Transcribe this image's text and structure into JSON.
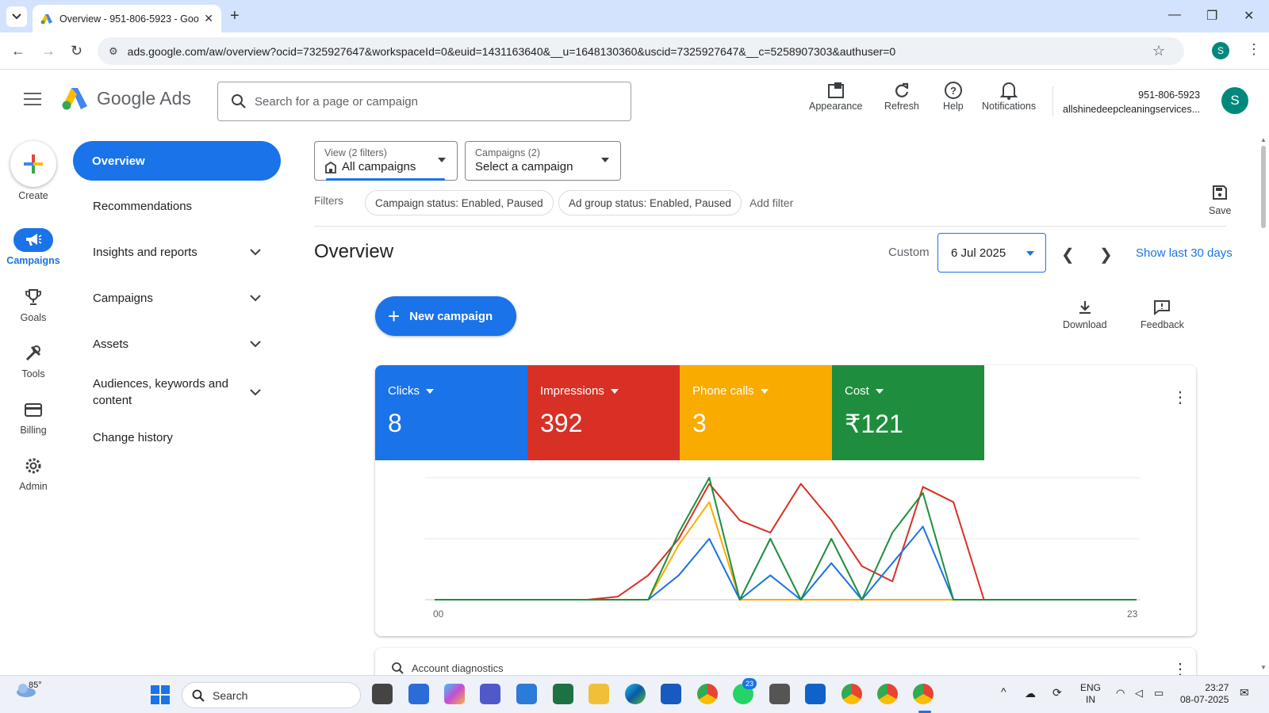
{
  "browser": {
    "tab_title": "Overview - 951-806-5923 - Goo",
    "url": "ads.google.com/aw/overview?ocid=7325927647&workspaceId=0&euid=1431163640&__u=1648130360&uscid=7325927647&__c=5258907303&authuser=0",
    "profile_initial": "S"
  },
  "header": {
    "logo_text": "Google Ads",
    "search_placeholder": "Search for a page or campaign",
    "tools": [
      {
        "label": "Appearance",
        "icon": "appearance-icon"
      },
      {
        "label": "Refresh",
        "icon": "refresh-icon"
      },
      {
        "label": "Help",
        "icon": "help-icon"
      },
      {
        "label": "Notifications",
        "icon": "bell-icon"
      }
    ],
    "account_id": "951-806-5923",
    "account_name": "allshinedeepcleaningservices...",
    "avatar_initial": "S"
  },
  "rail": [
    {
      "label": "Create",
      "icon": "plus-icon"
    },
    {
      "label": "Campaigns",
      "icon": "megaphone-icon",
      "active": true
    },
    {
      "label": "Goals",
      "icon": "trophy-icon"
    },
    {
      "label": "Tools",
      "icon": "tools-icon"
    },
    {
      "label": "Billing",
      "icon": "card-icon"
    },
    {
      "label": "Admin",
      "icon": "gear-icon"
    }
  ],
  "nav": {
    "overview": "Overview",
    "items": [
      {
        "label": "Recommendations",
        "expandable": false
      },
      {
        "label": "Insights and reports",
        "expandable": true
      },
      {
        "label": "Campaigns",
        "expandable": true
      },
      {
        "label": "Assets",
        "expandable": true
      },
      {
        "label": "Audiences, keywords and content",
        "expandable": true
      },
      {
        "label": "Change history",
        "expandable": false
      }
    ]
  },
  "main": {
    "view_dropdown": {
      "small": "View (2 filters)",
      "value": "All campaigns"
    },
    "campaign_dropdown": {
      "small": "Campaigns (2)",
      "value": "Select a campaign"
    },
    "filters_label": "Filters",
    "filter_chips": [
      "Campaign status: Enabled, Paused",
      "Ad group status: Enabled, Paused"
    ],
    "add_filter": "Add filter",
    "save_label": "Save",
    "title": "Overview",
    "custom_label": "Custom",
    "date": "6 Jul 2025",
    "show_last": "Show last 30 days",
    "new_campaign": "New campaign",
    "download": "Download",
    "feedback": "Feedback",
    "next_card_label": "Account diagnostics"
  },
  "metrics": [
    {
      "label": "Clicks",
      "value": "8",
      "color": "#1a73e8"
    },
    {
      "label": "Impressions",
      "value": "392",
      "color": "#d93025"
    },
    {
      "label": "Phone calls",
      "value": "3",
      "color": "#f9ab00"
    },
    {
      "label": "Cost",
      "value": "₹121",
      "color": "#1e8e3e"
    }
  ],
  "chart_data": {
    "type": "line",
    "x_tick_labels": [
      "00",
      "23"
    ],
    "x": [
      0,
      1,
      2,
      3,
      4,
      5,
      6,
      7,
      8,
      9,
      10,
      11,
      12,
      13,
      14,
      15,
      16,
      17,
      18,
      19,
      20,
      21,
      22,
      23
    ],
    "grid": true,
    "series": [
      {
        "metric": "Clicks",
        "color": "#1a73e8",
        "values": [
          0,
          0,
          0,
          0,
          0,
          0,
          0,
          0,
          0.4,
          1.0,
          0,
          0.4,
          0,
          0.6,
          0,
          0.6,
          1.2,
          0,
          0,
          0,
          0,
          0,
          0,
          0
        ]
      },
      {
        "metric": "Impressions",
        "color": "#d93025",
        "values": [
          0,
          0,
          0,
          0,
          0,
          0,
          0.05,
          0.4,
          1.0,
          1.9,
          1.3,
          1.1,
          1.9,
          1.3,
          0.55,
          0.3,
          1.85,
          1.6,
          0,
          0,
          0,
          0,
          0,
          0
        ]
      },
      {
        "metric": "Phone calls",
        "color": "#f9ab00",
        "values": [
          0,
          0,
          0,
          0,
          0,
          0,
          0,
          0,
          0.9,
          1.6,
          0,
          0,
          0,
          0,
          0,
          0,
          0,
          0,
          0,
          0,
          0,
          0,
          0,
          0
        ]
      },
      {
        "metric": "Cost",
        "color": "#1e8e3e",
        "values": [
          0,
          0,
          0,
          0,
          0,
          0,
          0,
          0,
          1.1,
          2.0,
          0,
          1.0,
          0,
          1.0,
          0,
          1.1,
          1.75,
          0,
          0,
          0,
          0,
          0,
          0,
          0
        ]
      }
    ]
  },
  "taskbar": {
    "weather": "85°",
    "search": "Search",
    "lang": "ENG",
    "region": "IN",
    "time": "23:27",
    "date": "08-07-2025",
    "badge": "23"
  }
}
